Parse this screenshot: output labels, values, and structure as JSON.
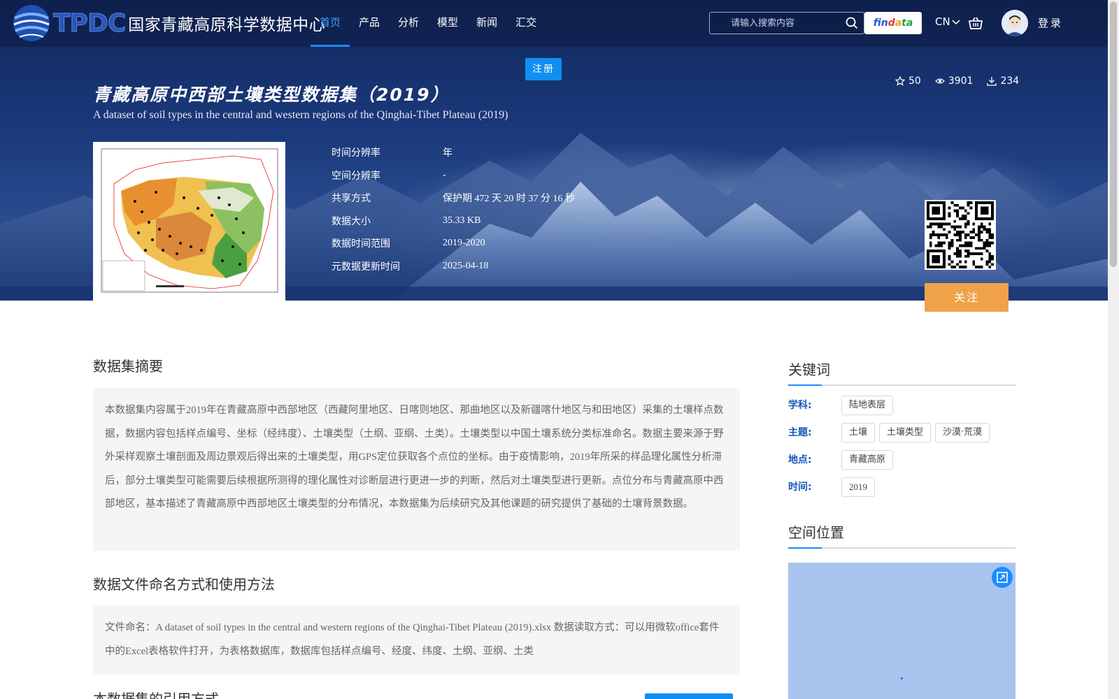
{
  "header": {
    "logo_abbr": "TPDC",
    "logo_name": "国家青藏高原科学数据中心",
    "nav": [
      {
        "label": "首页",
        "active": true
      },
      {
        "label": "产品"
      },
      {
        "label": "分析"
      },
      {
        "label": "模型"
      },
      {
        "label": "新闻"
      },
      {
        "label": "汇交"
      }
    ],
    "search_placeholder": "请输入搜索内容",
    "findata_parts": [
      "fin",
      "d",
      "a",
      "ta"
    ],
    "lang": "CN",
    "login": "登录"
  },
  "register_label": "注册",
  "dataset": {
    "title_cn": "青藏高原中西部土壤类型数据集（2019）",
    "title_en": "A dataset of soil types in the central and western regions of the Qinghai-Tibet Plateau (2019)",
    "stats": {
      "stars": "50",
      "views": "3901",
      "downloads": "234"
    },
    "meta": [
      {
        "label": "时间分辨率",
        "value": "年"
      },
      {
        "label": "空间分辨率",
        "value": "-"
      },
      {
        "label": "共享方式",
        "value": "保护期 472 天 20 时 37 分 16 秒"
      },
      {
        "label": "数据大小",
        "value": "35.33 KB"
      },
      {
        "label": "数据时间范围",
        "value": "2019-2020"
      },
      {
        "label": "元数据更新时间",
        "value": "2025-04-18"
      }
    ],
    "follow_label": "关注"
  },
  "summary": {
    "title": "数据集摘要",
    "text": "本数据集内容属于2019年在青藏高原中西部地区（西藏阿里地区、日喀则地区、那曲地区以及新疆喀什地区与和田地区）采集的土壤样点数据，数据内容包括样点编号、坐标（经纬度）、土壤类型（土纲、亚纲、土类）。土壤类型以中国土壤系统分类标准命名。数据主要来源于野外采样观察土壤剖面及周边景观后得出来的土壤类型，用GPS定位获取各个点位的坐标。由于疫情影响，2019年所采的样品理化属性分析滞后，部分土壤类型可能需要后续根据所测得的理化属性对诊断层进行更进一步的判断，然后对土壤类型进行更新。点位分布与青藏高原中西部地区，基本描述了青藏高原中西部地区土壤类型的分布情况，本数据集为后续研究及其他课题的研究提供了基础的土壤背景数据。"
  },
  "naming": {
    "title": "数据文件命名方式和使用方法",
    "text": "文件命名：A dataset of soil types in the central and western regions of the Qinghai-Tibet Plateau (2019).xlsx 数据读取方式：可以用微软office套件中的Excel表格软件打开，为表格数据库，数据库包括样点编号、经度、纬度、土纲、亚纲、土类"
  },
  "next_section_title": "本数据集的引用方式",
  "keywords": {
    "title": "关键词",
    "groups": [
      {
        "label": "学科:",
        "tags": [
          "陆地表层"
        ]
      },
      {
        "label": "主题:",
        "tags": [
          "土壤",
          "土壤类型",
          "沙漠·荒漠"
        ]
      },
      {
        "label": "地点:",
        "tags": [
          "青藏高原"
        ]
      },
      {
        "label": "时间:",
        "tags": [
          "2019"
        ]
      }
    ]
  },
  "location": {
    "title": "空间位置"
  },
  "colors": {
    "accent": "#1a8cff",
    "follow": "#f0a248",
    "keyword_label": "#1457b8"
  }
}
